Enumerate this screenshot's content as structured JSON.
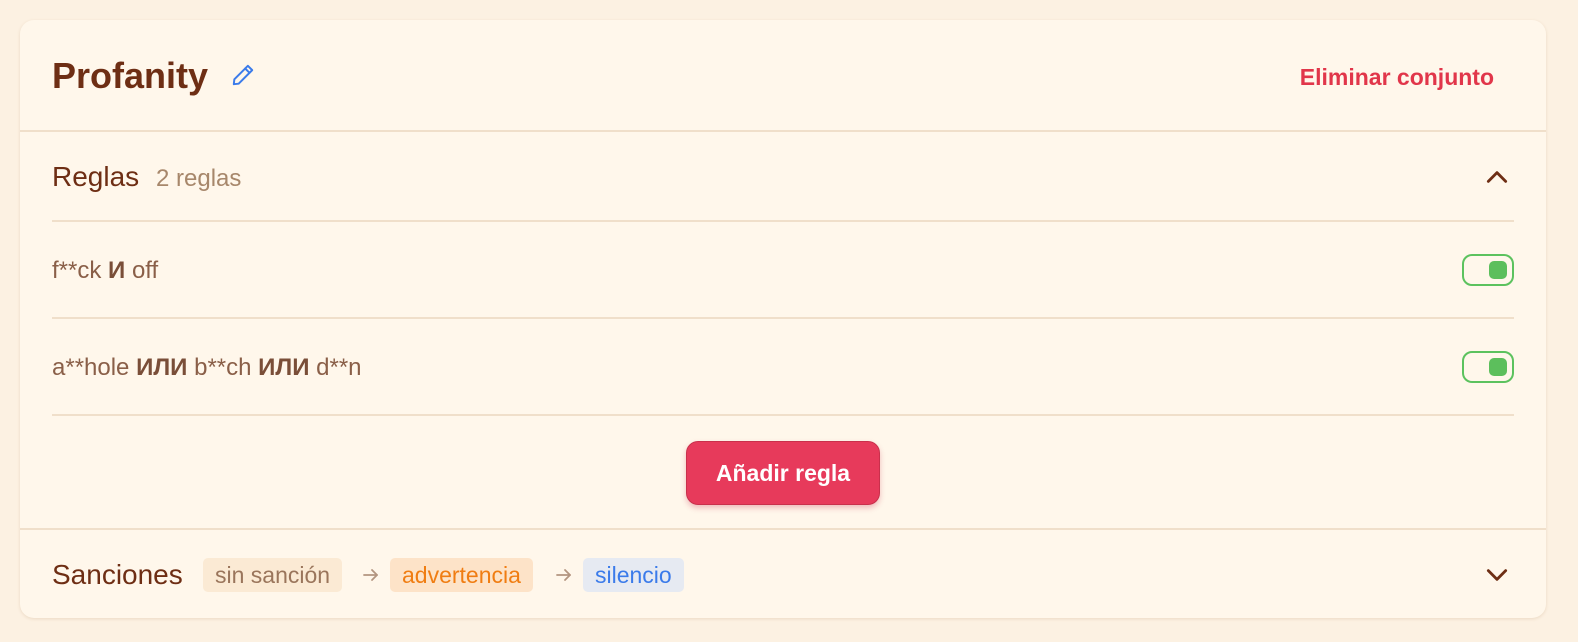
{
  "rule_set": {
    "title": "Profanity",
    "delete_label": "Eliminar conjunto"
  },
  "rules_section": {
    "title": "Reglas",
    "count": "2 reglas",
    "rules": [
      {
        "parts": [
          "f**ck",
          "И",
          "off"
        ],
        "enabled": true
      },
      {
        "parts": [
          "a**hole",
          "ИЛИ",
          "b**ch",
          "ИЛИ",
          "d**n"
        ],
        "enabled": true
      }
    ],
    "add_label": "Añadir regla"
  },
  "sanctions_section": {
    "title": "Sanciones",
    "steps": [
      "sin sanción",
      "advertencia",
      "silencio"
    ]
  },
  "icons": {
    "edit": "pencil-icon",
    "collapse": "chevron-up-icon",
    "expand": "chevron-down-icon",
    "arrow": "arrow-right-icon",
    "toggle": "toggle-switch"
  },
  "colors": {
    "background": "#fcf1e2",
    "card": "#fff7eb",
    "title": "#6e2e14",
    "danger": "#e1364a",
    "primary_button": "#e73a5b",
    "toggle_on": "#5cc25e",
    "sanction_warning": "#f07d12",
    "sanction_mute": "#3b7bea"
  }
}
